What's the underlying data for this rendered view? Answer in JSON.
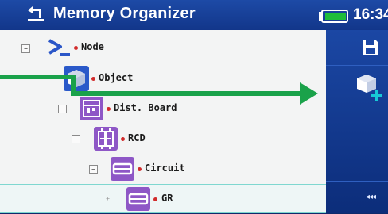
{
  "header": {
    "title": "Memory Organizer",
    "time": "16:34",
    "back_icon": "back-arrow-icon",
    "battery_icon": "battery-icon"
  },
  "tree": {
    "items": [
      {
        "label": "Node",
        "icon": "prompt-icon",
        "expander": "−",
        "level": 0
      },
      {
        "label": "Object",
        "icon": "cube-icon",
        "expander": "−",
        "level": 1
      },
      {
        "label": "Dist. Board",
        "icon": "panel-icon",
        "expander": "−",
        "level": 2
      },
      {
        "label": "RCD",
        "icon": "rcd-icon",
        "expander": "−",
        "level": 3
      },
      {
        "label": "Circuit",
        "icon": "circuit-icon",
        "expander": "−",
        "level": 4
      },
      {
        "label": "GR",
        "icon": "circuit-icon",
        "expander": "+",
        "level": 5,
        "selected": true
      }
    ]
  },
  "sidebar": {
    "save_icon": "save-icon",
    "add_icon": "add-object-icon",
    "more_label": "◂◂◂"
  },
  "colors": {
    "header_bg": "#1d4aa6",
    "sidebar_bg": "#1b47a4",
    "tree_bg": "#f3f4f4",
    "icon_purple": "#8e57c6",
    "bullet_red": "#d12b2b",
    "annotation_green": "#1aa24a",
    "selection_cyan": "#7fd7d0"
  }
}
